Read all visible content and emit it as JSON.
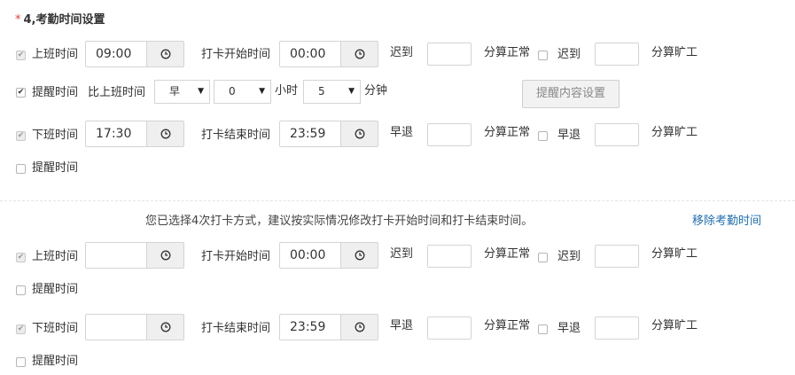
{
  "section": {
    "required_mark": "*",
    "title": "4,考勤时间设置"
  },
  "labels": {
    "on_duty": "上班时间",
    "off_duty": "下班时间",
    "punch_start": "打卡开始时间",
    "punch_end": "打卡结束时间",
    "late": "迟到",
    "early": "早退",
    "count_normal": "分算正常",
    "count_absent": "分算旷工",
    "reminder": "提醒时间",
    "before_on_duty": "比上班时间",
    "hours_unit": "小时",
    "minutes_unit": "分钟"
  },
  "shift1": {
    "on_time": "09:00",
    "punch_start": "00:00",
    "off_time": "17:30",
    "punch_end": "23:59",
    "reminder_on": {
      "direction": "早",
      "hours": "0",
      "minutes": "5"
    }
  },
  "shift2": {
    "on_time": "",
    "punch_start": "00:00",
    "off_time": "",
    "punch_end": "23:59"
  },
  "buttons": {
    "reminder_content": "提醒内容设置"
  },
  "notice": "您已选择4次打卡方式，建议按实际情况修改打卡开始时间和打卡结束时间。",
  "remove_link": "移除考勤时间",
  "colors": {
    "required_star": "#e4393c",
    "link": "#1f6fb2"
  }
}
